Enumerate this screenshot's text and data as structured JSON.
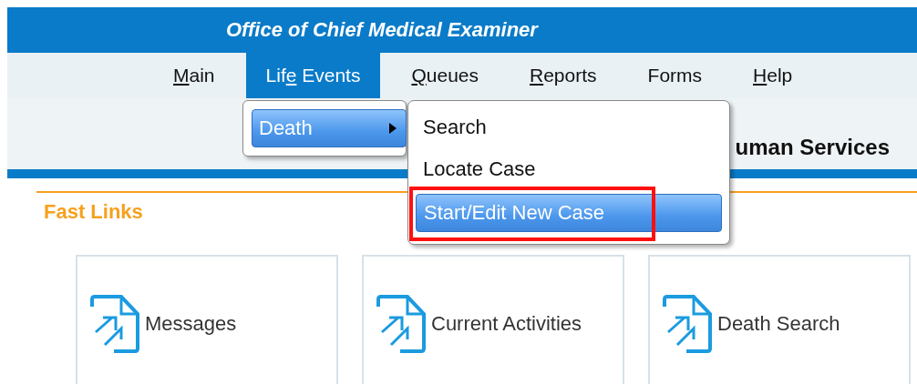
{
  "window": {
    "title": "Office of Chief Medical Examiner"
  },
  "menu_bar": [
    {
      "key": "M",
      "post": "ain",
      "selected": false
    },
    {
      "pre": "Lif",
      "key": "e",
      "post": " Events",
      "selected": true
    },
    {
      "key": "Q",
      "post": "ueues",
      "selected": false
    },
    {
      "key": "R",
      "post": "eports",
      "selected": false
    },
    {
      "pre": "Forms",
      "selected": false
    },
    {
      "key": "H",
      "post": "elp",
      "selected": false
    }
  ],
  "header_subtitle": "uman Services",
  "submenu": [
    {
      "label": "Death",
      "selected": true,
      "has_children": true
    }
  ],
  "death_menu": [
    {
      "label": "Search",
      "selected": false,
      "highlighted": false
    },
    {
      "label": "Locate Case",
      "selected": false,
      "highlighted": false
    },
    {
      "label": "Start/Edit New Case",
      "selected": true,
      "highlighted": true
    }
  ],
  "fast_links": {
    "title": "Fast Links",
    "items": [
      {
        "label": "Messages"
      },
      {
        "label": "Current Activities"
      },
      {
        "label": "Death Search"
      }
    ]
  }
}
